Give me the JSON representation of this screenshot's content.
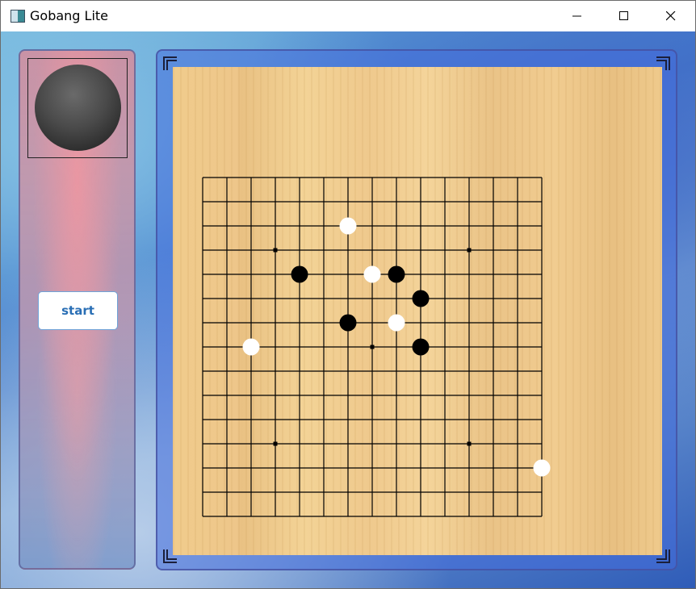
{
  "window": {
    "title": "Gobang Lite"
  },
  "side_panel": {
    "current_player": "black",
    "start_label": "start"
  },
  "board": {
    "size": 15,
    "star_points": [
      [
        3,
        3
      ],
      [
        3,
        11
      ],
      [
        7,
        7
      ],
      [
        11,
        3
      ],
      [
        11,
        11
      ]
    ],
    "stones": [
      {
        "color": "white",
        "col": 6,
        "row": 2
      },
      {
        "color": "black",
        "col": 4,
        "row": 4
      },
      {
        "color": "white",
        "col": 7,
        "row": 4
      },
      {
        "color": "black",
        "col": 8,
        "row": 4
      },
      {
        "color": "black",
        "col": 9,
        "row": 5
      },
      {
        "color": "black",
        "col": 6,
        "row": 6
      },
      {
        "color": "white",
        "col": 8,
        "row": 6
      },
      {
        "color": "white",
        "col": 2,
        "row": 7
      },
      {
        "color": "black",
        "col": 9,
        "row": 7
      },
      {
        "color": "white",
        "col": 14,
        "row": 12
      }
    ]
  },
  "colors": {
    "black_stone": "#000000",
    "white_stone": "#ffffff",
    "grid_line": "#000000",
    "start_text": "#2a6fb5"
  }
}
